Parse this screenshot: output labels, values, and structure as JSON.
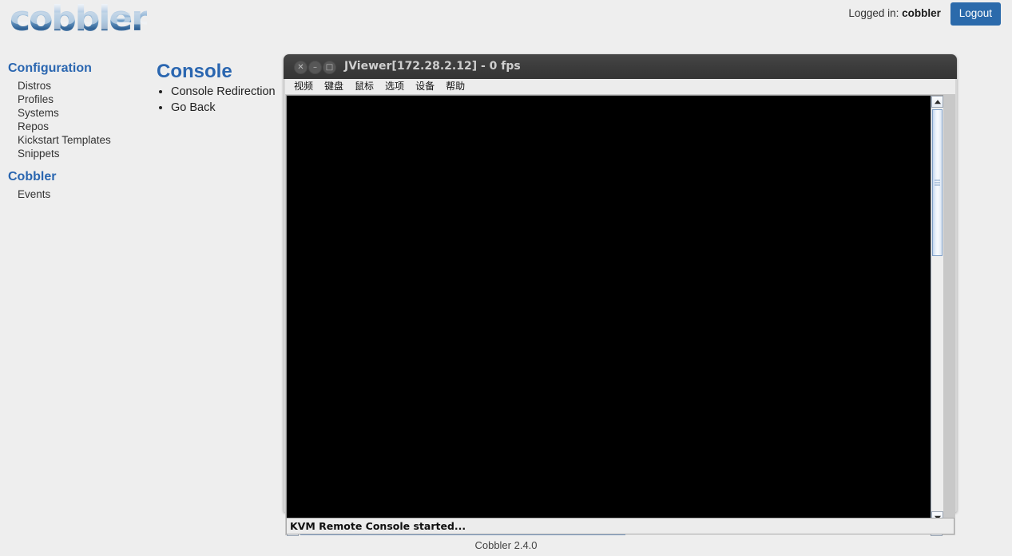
{
  "header": {
    "logo_text": "cobbler",
    "logged_in_label": "Logged in:",
    "username": "cobbler",
    "logout_label": "Logout",
    "accent_color": "#2b6aab"
  },
  "sidebar": {
    "groups": [
      {
        "title": "Configuration",
        "items": [
          {
            "label": "Distros"
          },
          {
            "label": "Profiles"
          },
          {
            "label": "Systems"
          },
          {
            "label": "Repos"
          },
          {
            "label": "Kickstart Templates"
          },
          {
            "label": "Snippets"
          }
        ]
      },
      {
        "title": "Cobbler",
        "items": [
          {
            "label": "Events"
          }
        ]
      }
    ]
  },
  "main": {
    "title": "Console",
    "actions": [
      {
        "label": "Console Redirection"
      },
      {
        "label": "Go Back"
      }
    ]
  },
  "jviewer": {
    "title": "JViewer[172.28.2.12] - 0 fps",
    "controls": {
      "close": "✕",
      "minimize": "–",
      "maximize": "□"
    },
    "menu": [
      {
        "label": "视频"
      },
      {
        "label": "键盘"
      },
      {
        "label": "鼠标"
      },
      {
        "label": "选项"
      },
      {
        "label": "设备"
      },
      {
        "label": "帮助"
      }
    ],
    "status_text": "KVM Remote Console started...",
    "canvas_color": "#000000",
    "titlebar_color": "#3b3b3b"
  },
  "footer": {
    "text": "Cobbler 2.4.0"
  }
}
